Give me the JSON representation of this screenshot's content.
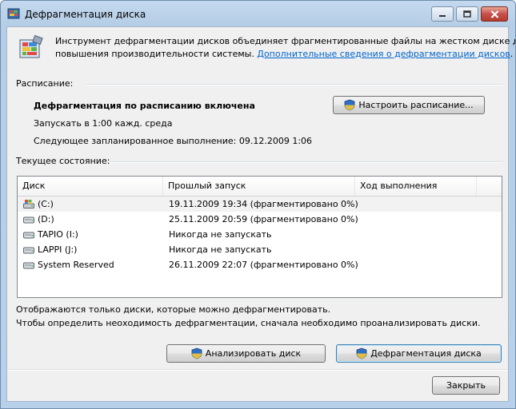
{
  "window": {
    "title": "Дефрагментация диска",
    "controls": {
      "minimize": "minimize-icon",
      "maximize": "maximize-icon",
      "close": "close-icon"
    }
  },
  "header": {
    "description_line1": "Инструмент дефрагментации дисков объединяет фрагментированные файлы на жестком диске для",
    "description_line2": "повышения производительности системы.",
    "link_text": "Дополнительные сведения о дефрагментации дисков",
    "link_suffix": "."
  },
  "schedule": {
    "section_label": "Расписание:",
    "status": "Дефрагментация по расписанию включена",
    "run_when": "Запускать в 1:00 кажд. среда",
    "next_run": "Следующее запланированное выполнение: 09.12.2009 1:06",
    "configure_button": "Настроить расписание..."
  },
  "current_state": {
    "section_label": "Текущее состояние:",
    "columns": [
      "Диск",
      "Прошлый запуск",
      "Ход выполнения"
    ],
    "disks": [
      {
        "name": "(C:)",
        "last_run": "19.11.2009 19:34 (фрагментировано 0%)",
        "progress": "",
        "icon": "system-drive-icon"
      },
      {
        "name": "(D:)",
        "last_run": "25.11.2009 20:59 (фрагментировано 0%)",
        "progress": "",
        "icon": "hard-drive-icon"
      },
      {
        "name": "TAPIO (I:)",
        "last_run": "Никогда не запускать",
        "progress": "",
        "icon": "hard-drive-icon"
      },
      {
        "name": "LAPPI (J:)",
        "last_run": "Никогда не запускать",
        "progress": "",
        "icon": "hard-drive-icon"
      },
      {
        "name": "System Reserved",
        "last_run": "26.11.2009 22:07 (фрагментировано 0%)",
        "progress": "",
        "icon": "hard-drive-icon"
      }
    ]
  },
  "footer": {
    "note_line1": "Отображаются только диски, которые можно дефрагментировать.",
    "note_line2": "Чтобы определить неоходимость  дефрагментации, сначала необходимо проанализировать диски.",
    "analyze_button": "Анализировать диск",
    "defrag_button": "Дефрагментация диска",
    "close_button": "Закрыть"
  },
  "colors": {
    "link": "#0066cc",
    "client_bg": "#f0f0f0",
    "titlebar": "#b9d0ea",
    "close_button": "#c75050"
  }
}
